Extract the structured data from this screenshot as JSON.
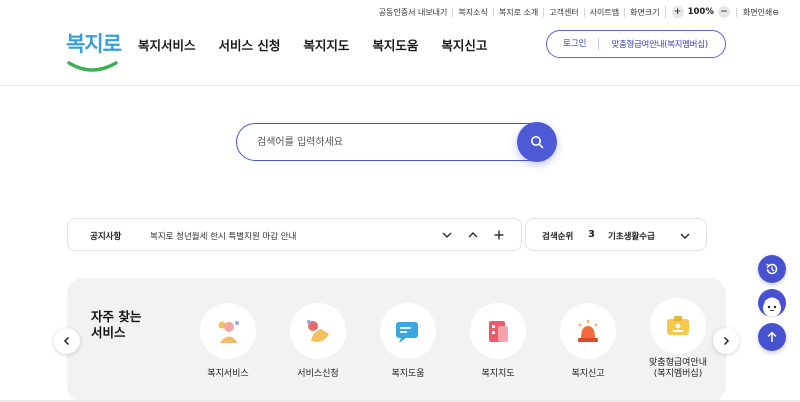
{
  "util_bar": {
    "items": [
      "공동인증서 내보내기",
      "복지소식",
      "복지로 소개",
      "고객센터",
      "사이트맵",
      "화면크기"
    ],
    "zoom_value": "100%",
    "zoom_in": "+",
    "zoom_out": "−",
    "reset": "화면인쇄⊖"
  },
  "logo": {
    "text": "복지로"
  },
  "nav": {
    "items": [
      "복지서비스",
      "서비스 신청",
      "복지지도",
      "복지도움",
      "복지신고"
    ]
  },
  "header_buttons": {
    "login": "로그인",
    "custom": "맞춤형급여안내(복지멤버십)"
  },
  "search": {
    "placeholder": "검색어를 입력하세요"
  },
  "notice": {
    "label": "공지사항",
    "text": "복지로 청년월세 한시 특별지원 마감 안내"
  },
  "rank": {
    "label": "검색순위",
    "number": "3",
    "term": "기초생활수급"
  },
  "frequent": {
    "title_line1": "자주 찾는",
    "title_line2": "서비스",
    "items": [
      {
        "label": "복지서비스",
        "icon": "person-coin-icon"
      },
      {
        "label": "서비스신청",
        "icon": "hand-ball-icon"
      },
      {
        "label": "복지도움",
        "icon": "chat-bubble-icon"
      },
      {
        "label": "복지지도",
        "icon": "building-icon"
      },
      {
        "label": "복지신고",
        "icon": "siren-icon"
      },
      {
        "label_line1": "맞춤형급여안내",
        "label_line2": "(복지멤버십)",
        "icon": "id-card-icon"
      }
    ]
  },
  "colors": {
    "brand": "#4652cf",
    "logo": "#3a9fd9",
    "panel": "#f2f2f3"
  }
}
